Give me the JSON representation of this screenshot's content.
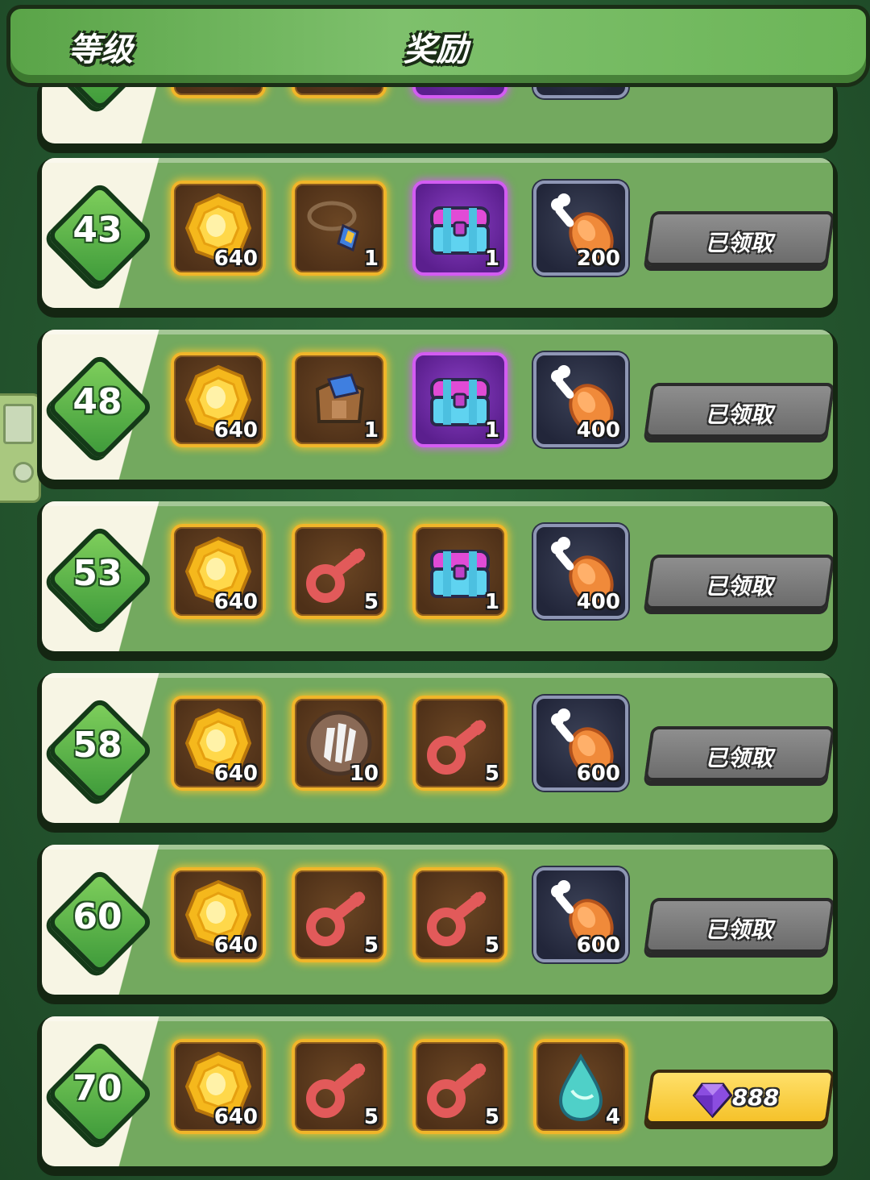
{
  "header": {
    "level_label": "等级",
    "reward_label": "奖励"
  },
  "rows": [
    {
      "level": "",
      "partial": true,
      "items": [
        {
          "type": "coin",
          "frame": "gold",
          "qty": ""
        },
        {
          "type": "coin",
          "frame": "gold",
          "qty": ""
        },
        {
          "type": "chest",
          "frame": "purple",
          "qty": ""
        },
        {
          "type": "meat",
          "frame": "dark",
          "qty": ""
        }
      ],
      "button": {
        "state": "claimed",
        "label": ""
      }
    },
    {
      "level": "43",
      "items": [
        {
          "type": "coin",
          "frame": "gold",
          "qty": "640"
        },
        {
          "type": "necklace",
          "frame": "gold",
          "qty": "1"
        },
        {
          "type": "chest",
          "frame": "purple",
          "qty": "1"
        },
        {
          "type": "meat",
          "frame": "dark",
          "qty": "200"
        }
      ],
      "button": {
        "state": "claimed",
        "label": "已领取"
      }
    },
    {
      "level": "48",
      "items": [
        {
          "type": "coin",
          "frame": "gold",
          "qty": "640"
        },
        {
          "type": "armor",
          "frame": "gold",
          "qty": "1"
        },
        {
          "type": "chest",
          "frame": "purple",
          "qty": "1"
        },
        {
          "type": "meat",
          "frame": "dark",
          "qty": "400"
        }
      ],
      "button": {
        "state": "claimed",
        "label": "已领取"
      }
    },
    {
      "level": "53",
      "items": [
        {
          "type": "coin",
          "frame": "gold",
          "qty": "640"
        },
        {
          "type": "key",
          "frame": "gold",
          "qty": "5"
        },
        {
          "type": "chest",
          "frame": "gold",
          "qty": "1"
        },
        {
          "type": "meat",
          "frame": "dark",
          "qty": "400"
        }
      ],
      "button": {
        "state": "claimed",
        "label": "已领取"
      }
    },
    {
      "level": "58",
      "items": [
        {
          "type": "coin",
          "frame": "gold",
          "qty": "640"
        },
        {
          "type": "claw-token",
          "frame": "gold",
          "qty": "10"
        },
        {
          "type": "key",
          "frame": "gold",
          "qty": "5"
        },
        {
          "type": "meat",
          "frame": "dark",
          "qty": "600"
        }
      ],
      "button": {
        "state": "claimed",
        "label": "已领取"
      }
    },
    {
      "level": "60",
      "items": [
        {
          "type": "coin",
          "frame": "gold",
          "qty": "640"
        },
        {
          "type": "key",
          "frame": "gold",
          "qty": "5"
        },
        {
          "type": "key",
          "frame": "gold",
          "qty": "5"
        },
        {
          "type": "meat",
          "frame": "dark",
          "qty": "600"
        }
      ],
      "button": {
        "state": "claimed",
        "label": "已领取"
      }
    },
    {
      "level": "70",
      "items": [
        {
          "type": "coin",
          "frame": "gold",
          "qty": "640"
        },
        {
          "type": "key",
          "frame": "gold",
          "qty": "5"
        },
        {
          "type": "key",
          "frame": "gold",
          "qty": "5"
        },
        {
          "type": "water-drop",
          "frame": "gold",
          "qty": "4"
        }
      ],
      "button": {
        "state": "purchase",
        "label": "888",
        "icon": "gem-icon"
      }
    }
  ],
  "colors": {
    "claimed_button": "#7a7a7a",
    "purchase_button": "#f5c22a",
    "gold_frame": "#f0b52a",
    "purple_frame": "#d35cf2",
    "dark_frame": "#8e96b4"
  }
}
